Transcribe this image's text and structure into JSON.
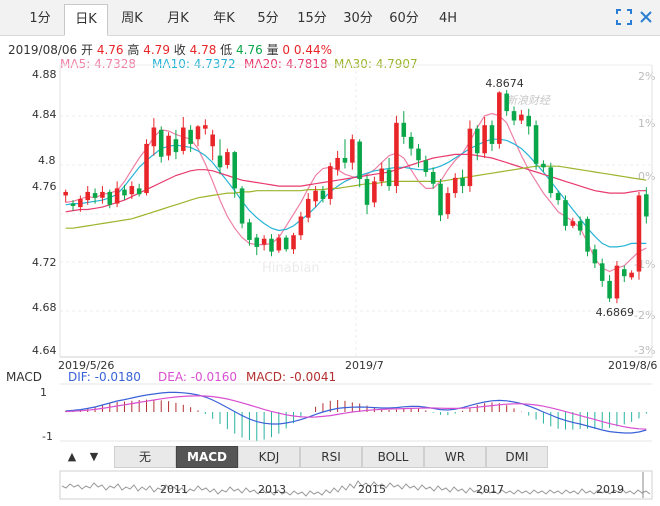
{
  "tabs": [
    "1分",
    "日K",
    "周K",
    "月K",
    "年K",
    "5分",
    "15分",
    "30分",
    "60分",
    "4H"
  ],
  "active_tab": 1,
  "quote": {
    "date": "2019/08/06",
    "open_label": "开",
    "open": "4.76",
    "high_label": "高",
    "high": "4.79",
    "close_label": "收",
    "close": "4.78",
    "low_label": "低",
    "low": "4.76",
    "vol_label": "量",
    "vol": "0",
    "change": "0.44%"
  },
  "ma": [
    {
      "label": "MA5:",
      "value": "4.7328",
      "color": "#ef7fa6"
    },
    {
      "label": "MA10:",
      "value": "4.7372",
      "color": "#27b3d6"
    },
    {
      "label": "MA20:",
      "value": "4.7818",
      "color": "#e83a6e"
    },
    {
      "label": "MA30:",
      "value": "4.7907",
      "color": "#9bb52c"
    }
  ],
  "macd": {
    "label": "MACD",
    "dif_label": "DIF:",
    "dif": "-0.0180",
    "dif_color": "#3a62d8",
    "dea_label": "DEA:",
    "dea": "-0.0160",
    "dea_color": "#d94fd0",
    "macd_label": "MACD:",
    "macd_value": "-0.0041",
    "macd_color": "#b32f2f",
    "y_top": "1",
    "y_bottom": "-1"
  },
  "indicators": [
    "无",
    "MACD",
    "KDJ",
    "RSI",
    "BOLL",
    "WR",
    "DMI"
  ],
  "active_indicator": 1,
  "nav_buttons": [
    "▲",
    "▼"
  ],
  "timeline_years": [
    "2011",
    "2013",
    "2015",
    "2017",
    "2019"
  ],
  "watermark": {
    "brand": "新浪财经",
    "sub": "Hinabian"
  },
  "colors": {
    "up": "#e8262a",
    "down": "#0aa64a"
  },
  "chart_data": {
    "type": "candlestick",
    "y_ticks": [
      "4.88",
      "4.84",
      "4.8",
      "4.76",
      "4.72",
      "4.68",
      "4.64"
    ],
    "y_right_ticks": [
      "2%",
      "1%",
      "0%",
      "-1%",
      "-2%",
      "-3%"
    ],
    "ylim": [
      4.64,
      4.88
    ],
    "x_ticks": [
      "2019/5/26",
      "2019/7",
      "2019/8/6"
    ],
    "annotations": [
      {
        "text": "4.8674",
        "index": 59
      },
      {
        "text": "4.6869",
        "index": 74
      }
    ],
    "candles": [
      [
        4.778,
        4.781,
        4.772,
        4.783
      ],
      [
        4.771,
        4.769,
        4.765,
        4.774
      ],
      [
        4.768,
        4.775,
        4.764,
        4.778
      ],
      [
        4.774,
        4.781,
        4.77,
        4.786
      ],
      [
        4.78,
        4.776,
        4.771,
        4.784
      ],
      [
        4.776,
        4.781,
        4.771,
        4.786
      ],
      [
        4.781,
        4.77,
        4.767,
        4.783
      ],
      [
        4.771,
        4.784,
        4.768,
        4.79
      ],
      [
        4.783,
        4.778,
        4.774,
        4.787
      ],
      [
        4.779,
        4.786,
        4.775,
        4.79
      ],
      [
        4.784,
        4.779,
        4.777,
        4.788
      ],
      [
        4.78,
        4.822,
        4.778,
        4.826
      ],
      [
        4.82,
        4.836,
        4.812,
        4.844
      ],
      [
        4.834,
        4.811,
        4.806,
        4.837
      ],
      [
        4.812,
        4.829,
        4.808,
        4.832
      ],
      [
        4.826,
        4.815,
        4.809,
        4.834
      ],
      [
        4.816,
        4.836,
        4.813,
        4.845
      ],
      [
        4.834,
        4.822,
        4.815,
        4.838
      ],
      [
        4.826,
        4.837,
        4.82,
        4.838
      ],
      [
        4.835,
        4.838,
        4.83,
        4.843
      ],
      [
        4.82,
        4.83,
        4.808,
        4.834
      ],
      [
        4.812,
        4.802,
        4.796,
        4.826
      ],
      [
        4.804,
        4.815,
        4.801,
        4.818
      ],
      [
        4.815,
        4.784,
        4.776,
        4.816
      ],
      [
        4.784,
        4.754,
        4.75,
        4.786
      ],
      [
        4.755,
        4.74,
        4.735,
        4.758
      ],
      [
        4.742,
        4.734,
        4.727,
        4.745
      ],
      [
        4.736,
        4.741,
        4.731,
        4.744
      ],
      [
        4.741,
        4.73,
        4.726,
        4.745
      ],
      [
        4.731,
        4.742,
        4.729,
        4.745
      ],
      [
        4.742,
        4.732,
        4.73,
        4.744
      ],
      [
        4.732,
        4.744,
        4.728,
        4.746
      ],
      [
        4.744,
        4.76,
        4.74,
        4.764
      ],
      [
        4.759,
        4.775,
        4.755,
        4.78
      ],
      [
        4.773,
        4.782,
        4.768,
        4.786
      ],
      [
        4.782,
        4.775,
        4.772,
        4.786
      ],
      [
        4.775,
        4.803,
        4.77,
        4.806
      ],
      [
        4.8,
        4.81,
        4.795,
        4.816
      ],
      [
        4.81,
        4.806,
        4.801,
        4.826
      ],
      [
        4.806,
        4.826,
        4.8,
        4.83
      ],
      [
        4.824,
        4.792,
        4.785,
        4.826
      ],
      [
        4.792,
        4.77,
        4.762,
        4.795
      ],
      [
        4.772,
        4.79,
        4.768,
        4.794
      ],
      [
        4.79,
        4.801,
        4.786,
        4.806
      ],
      [
        4.8,
        4.786,
        4.782,
        4.81
      ],
      [
        4.786,
        4.84,
        4.78,
        4.846
      ],
      [
        4.84,
        4.828,
        4.822,
        4.85
      ],
      [
        4.828,
        4.818,
        4.812,
        4.832
      ],
      [
        4.818,
        4.808,
        4.802,
        4.822
      ],
      [
        4.808,
        4.798,
        4.794,
        4.812
      ],
      [
        4.798,
        4.788,
        4.784,
        4.802
      ],
      [
        4.788,
        4.761,
        4.756,
        4.792
      ],
      [
        4.762,
        4.78,
        4.758,
        4.785
      ],
      [
        4.78,
        4.793,
        4.776,
        4.797
      ],
      [
        4.793,
        4.786,
        4.78,
        4.8
      ],
      [
        4.786,
        4.835,
        4.781,
        4.842
      ],
      [
        4.835,
        4.814,
        4.808,
        4.838
      ],
      [
        4.814,
        4.838,
        4.81,
        4.845
      ],
      [
        4.838,
        4.822,
        4.816,
        4.842
      ],
      [
        4.822,
        4.866,
        4.818,
        4.867
      ],
      [
        4.865,
        4.85,
        4.846,
        4.868
      ],
      [
        4.85,
        4.842,
        4.838,
        4.854
      ],
      [
        4.842,
        4.847,
        4.839,
        4.851
      ],
      [
        4.846,
        4.837,
        4.83,
        4.852
      ],
      [
        4.838,
        4.805,
        4.8,
        4.842
      ],
      [
        4.805,
        4.802,
        4.798,
        4.808
      ],
      [
        4.802,
        4.78,
        4.776,
        4.806
      ],
      [
        4.78,
        4.774,
        4.77,
        4.782
      ],
      [
        4.774,
        4.752,
        4.748,
        4.778
      ],
      [
        4.752,
        4.756,
        4.75,
        4.759
      ],
      [
        4.756,
        4.748,
        4.744,
        4.76
      ],
      [
        4.758,
        4.73,
        4.726,
        4.76
      ],
      [
        4.732,
        4.72,
        4.716,
        4.736
      ],
      [
        4.72,
        4.705,
        4.7,
        4.724
      ],
      [
        4.705,
        4.69,
        4.687,
        4.71
      ],
      [
        4.69,
        4.718,
        4.686,
        4.722
      ],
      [
        4.715,
        4.709,
        4.704,
        4.718
      ],
      [
        4.708,
        4.712,
        4.706,
        4.714
      ],
      [
        4.713,
        4.778,
        4.706,
        4.781
      ],
      [
        4.779,
        4.76,
        4.754,
        4.785
      ]
    ],
    "ma_series": [
      {
        "name": "MA5",
        "color": "#ef7fa6",
        "values": [
          4.772,
          4.773,
          4.775,
          4.777,
          4.776,
          4.779,
          4.78,
          4.782,
          4.79,
          4.8,
          4.81,
          4.818,
          4.828,
          4.834,
          4.833,
          4.83,
          4.828,
          4.826,
          4.818,
          4.805,
          4.79,
          4.774,
          4.76,
          4.75,
          4.742,
          4.737,
          4.736,
          4.736,
          4.737,
          4.742,
          4.752,
          4.762,
          4.772,
          4.784,
          4.795,
          4.801,
          4.802,
          4.8,
          4.796,
          4.794,
          4.793,
          4.796,
          4.8,
          4.806,
          4.812,
          4.814,
          4.81,
          4.8,
          4.79,
          4.784,
          4.784,
          4.79,
          4.8,
          4.808,
          4.814,
          4.824,
          4.836,
          4.846,
          4.848,
          4.846,
          4.84,
          4.826,
          4.812,
          4.8,
          4.79,
          4.78,
          4.772,
          4.764,
          4.76,
          4.756,
          4.75,
          4.738,
          4.724,
          4.716,
          4.713,
          4.716,
          4.718,
          4.724,
          4.73,
          4.733
        ]
      },
      {
        "name": "MA10",
        "color": "#27b3d6",
        "values": [
          4.77,
          4.771,
          4.771,
          4.772,
          4.773,
          4.774,
          4.776,
          4.779,
          4.786,
          4.794,
          4.802,
          4.808,
          4.813,
          4.818,
          4.82,
          4.821,
          4.82,
          4.819,
          4.816,
          4.812,
          4.806,
          4.798,
          4.79,
          4.782,
          4.773,
          4.765,
          4.759,
          4.754,
          4.75,
          4.748,
          4.749,
          4.752,
          4.757,
          4.762,
          4.768,
          4.775,
          4.781,
          4.786,
          4.79,
          4.793,
          4.795,
          4.797,
          4.799,
          4.8,
          4.801,
          4.802,
          4.802,
          4.801,
          4.8,
          4.8,
          4.801,
          4.803,
          4.806,
          4.81,
          4.814,
          4.818,
          4.821,
          4.824,
          4.826,
          4.826,
          4.825,
          4.822,
          4.818,
          4.812,
          4.805,
          4.798,
          4.79,
          4.782,
          4.774,
          4.766,
          4.758,
          4.75,
          4.743,
          4.737,
          4.734,
          4.734,
          4.735,
          4.737,
          4.737,
          4.737
        ]
      },
      {
        "name": "MA20",
        "color": "#e83a6e",
        "values": [
          4.764,
          4.765,
          4.766,
          4.766,
          4.767,
          4.768,
          4.77,
          4.772,
          4.774,
          4.777,
          4.78,
          4.783,
          4.786,
          4.789,
          4.792,
          4.795,
          4.797,
          4.799,
          4.8,
          4.8,
          4.799,
          4.797,
          4.795,
          4.793,
          4.791,
          4.79,
          4.789,
          4.788,
          4.787,
          4.786,
          4.786,
          4.786,
          4.786,
          4.787,
          4.788,
          4.789,
          4.79,
          4.791,
          4.792,
          4.793,
          4.794,
          4.795,
          4.796,
          4.797,
          4.798,
          4.8,
          4.802,
          4.804,
          4.806,
          4.808,
          4.81,
          4.811,
          4.812,
          4.813,
          4.813,
          4.813,
          4.812,
          4.811,
          4.81,
          4.808,
          4.806,
          4.804,
          4.802,
          4.8,
          4.798,
          4.796,
          4.794,
          4.792,
          4.79,
          4.788,
          4.786,
          4.784,
          4.782,
          4.781,
          4.78,
          4.78,
          4.78,
          4.781,
          4.782,
          4.782
        ]
      },
      {
        "name": "MA30",
        "color": "#9bb52c",
        "values": [
          4.75,
          4.75,
          4.751,
          4.752,
          4.753,
          4.754,
          4.755,
          4.756,
          4.757,
          4.758,
          4.76,
          4.762,
          4.764,
          4.766,
          4.768,
          4.77,
          4.772,
          4.774,
          4.776,
          4.777,
          4.778,
          4.779,
          4.78,
          4.78,
          4.781,
          4.781,
          4.782,
          4.782,
          4.782,
          4.782,
          4.782,
          4.782,
          4.782,
          4.783,
          4.783,
          4.783,
          4.784,
          4.784,
          4.785,
          4.786,
          4.787,
          4.788,
          4.788,
          4.789,
          4.79,
          4.79,
          4.79,
          4.79,
          4.79,
          4.79,
          4.79,
          4.79,
          4.791,
          4.792,
          4.793,
          4.794,
          4.795,
          4.796,
          4.797,
          4.798,
          4.799,
          4.8,
          4.801,
          4.802,
          4.803,
          4.803,
          4.803,
          4.803,
          4.802,
          4.801,
          4.8,
          4.799,
          4.798,
          4.797,
          4.796,
          4.795,
          4.794,
          4.793,
          4.792,
          4.791
        ]
      }
    ],
    "macd_ylim": [
      -1.5,
      1.5
    ],
    "macd_dif": [
      0.05,
      0.08,
      0.12,
      0.18,
      0.25,
      0.35,
      0.45,
      0.55,
      0.62,
      0.7,
      0.78,
      0.85,
      0.9,
      0.95,
      0.98,
      0.98,
      0.96,
      0.92,
      0.85,
      0.75,
      0.6,
      0.42,
      0.22,
      0.02,
      -0.18,
      -0.35,
      -0.48,
      -0.56,
      -0.6,
      -0.6,
      -0.55,
      -0.48,
      -0.38,
      -0.26,
      -0.12,
      0.0,
      0.1,
      0.18,
      0.22,
      0.24,
      0.25,
      0.24,
      0.22,
      0.2,
      0.2,
      0.22,
      0.26,
      0.28,
      0.28,
      0.24,
      0.18,
      0.12,
      0.1,
      0.14,
      0.22,
      0.32,
      0.42,
      0.5,
      0.56,
      0.58,
      0.56,
      0.5,
      0.42,
      0.3,
      0.16,
      0.0,
      -0.15,
      -0.3,
      -0.42,
      -0.52,
      -0.6,
      -0.7,
      -0.8,
      -0.9,
      -0.98,
      -1.02,
      -1.05,
      -1.05,
      -1.0,
      -0.9
    ],
    "macd_dea": [
      0.02,
      0.04,
      0.06,
      0.09,
      0.13,
      0.18,
      0.24,
      0.3,
      0.36,
      0.42,
      0.48,
      0.54,
      0.6,
      0.66,
      0.71,
      0.75,
      0.78,
      0.8,
      0.81,
      0.8,
      0.77,
      0.72,
      0.65,
      0.56,
      0.46,
      0.35,
      0.24,
      0.13,
      0.03,
      -0.06,
      -0.14,
      -0.2,
      -0.24,
      -0.26,
      -0.25,
      -0.22,
      -0.18,
      -0.12,
      -0.06,
      0.0,
      0.04,
      0.08,
      0.11,
      0.13,
      0.15,
      0.16,
      0.17,
      0.18,
      0.19,
      0.2,
      0.2,
      0.19,
      0.18,
      0.18,
      0.19,
      0.21,
      0.24,
      0.28,
      0.32,
      0.36,
      0.39,
      0.41,
      0.41,
      0.39,
      0.35,
      0.29,
      0.21,
      0.12,
      0.02,
      -0.08,
      -0.18,
      -0.28,
      -0.38,
      -0.48,
      -0.58,
      -0.66,
      -0.74,
      -0.8,
      -0.84,
      -0.86
    ]
  }
}
